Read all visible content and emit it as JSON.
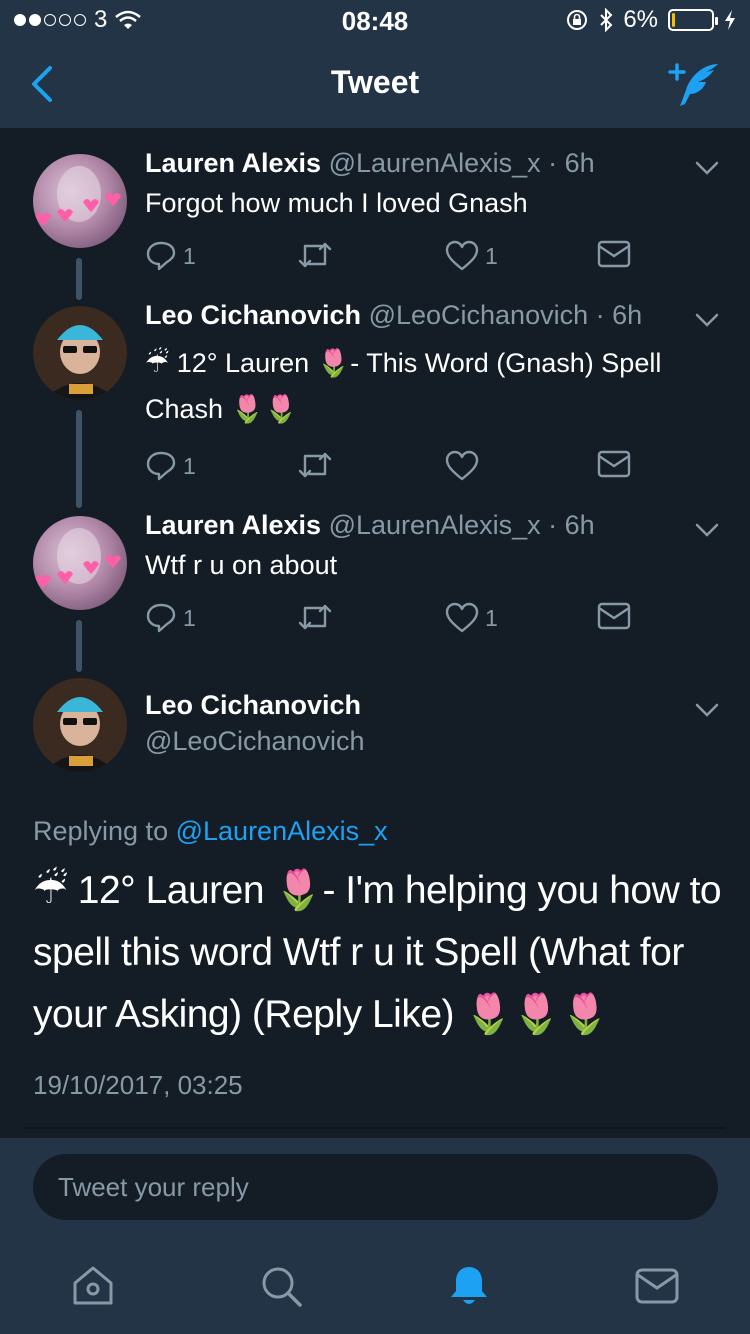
{
  "status_bar": {
    "carrier": "3",
    "time": "08:48",
    "battery": "6%",
    "battery_level": 0.06
  },
  "header": {
    "title": "Tweet"
  },
  "tweets": [
    {
      "name": "Lauren Alexis",
      "handle": "@LaurenAlexis_x",
      "time": "· 6h",
      "text": "Forgot how much I loved Gnash",
      "reply_count": "1",
      "retweet_count": "",
      "like_count": "1"
    },
    {
      "name": "Leo Cichanovich",
      "handle": "@LeoCichanovich",
      "time": "· 6h",
      "text": "☔ 12° Lauren 🌷- This Word (Gnash) Spell Chash 🌷🌷",
      "reply_count": "1",
      "retweet_count": "",
      "like_count": ""
    },
    {
      "name": "Lauren Alexis",
      "handle": "@LaurenAlexis_x",
      "time": "· 6h",
      "text": "Wtf r u on about",
      "reply_count": "1",
      "retweet_count": "",
      "like_count": "1"
    }
  ],
  "focus_tweet": {
    "name": "Leo Cichanovich",
    "handle": "@LeoCichanovich",
    "replying_label": "Replying to",
    "replying_to": "@LaurenAlexis_x",
    "text": "☔ 12° Lauren 🌷- I'm helping you how to spell this word Wtf r u it Spell (What for your Asking) (Reply Like) 🌷🌷🌷",
    "datetime": "19/10/2017, 03:25"
  },
  "reply_bar": {
    "placeholder": "Tweet your reply"
  },
  "colors": {
    "accent": "#1da1f2",
    "background": "#141d26",
    "bar": "#243447",
    "muted": "#8899a6"
  }
}
